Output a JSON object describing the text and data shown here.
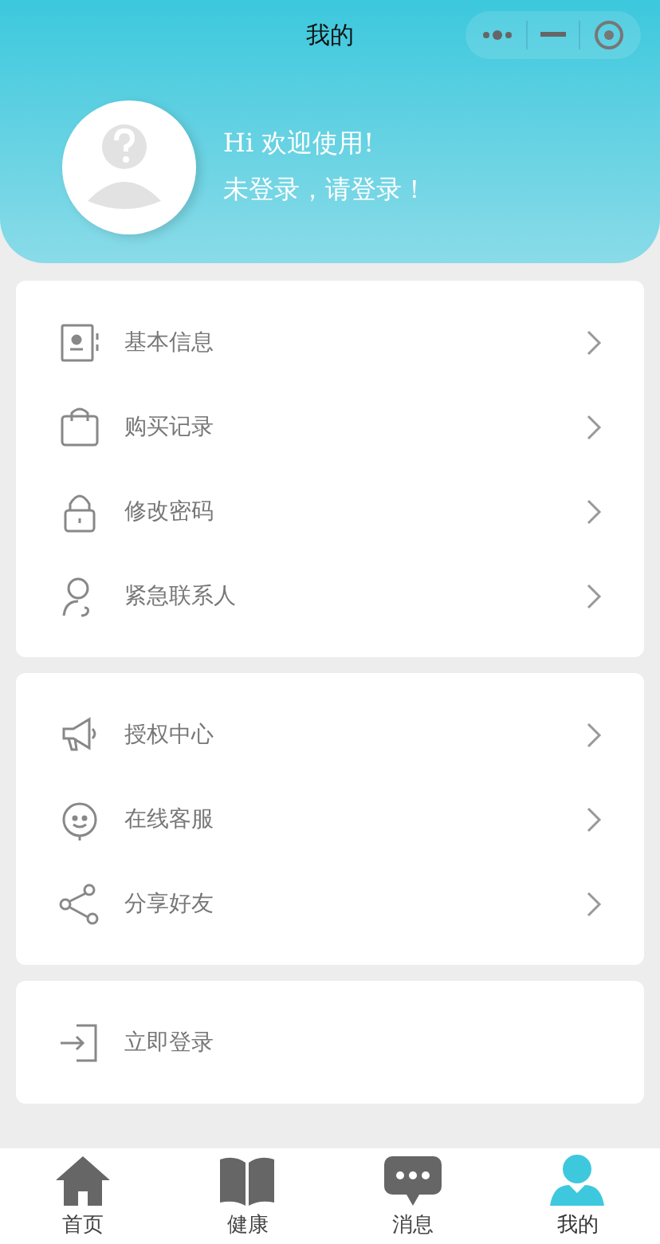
{
  "title": "我的",
  "profile": {
    "greeting": "Hi 欢迎使用!",
    "status": "未登录，请登录！"
  },
  "groups": [
    {
      "items": [
        {
          "kind": "card",
          "label": "基本信息",
          "arrow": true
        },
        {
          "kind": "bag",
          "label": "购买记录",
          "arrow": true
        },
        {
          "kind": "lock",
          "label": "修改密码",
          "arrow": true
        },
        {
          "kind": "contact",
          "label": "紧急联系人",
          "arrow": true
        }
      ]
    },
    {
      "items": [
        {
          "kind": "megaphone",
          "label": "授权中心",
          "arrow": true
        },
        {
          "kind": "service",
          "label": "在线客服",
          "arrow": true
        },
        {
          "kind": "share",
          "label": "分享好友",
          "arrow": true
        }
      ]
    },
    {
      "items": [
        {
          "kind": "login",
          "label": "立即登录",
          "arrow": false
        }
      ]
    }
  ],
  "tabs": [
    {
      "kind": "home",
      "label": "首页",
      "selected": false
    },
    {
      "kind": "book",
      "label": "健康",
      "selected": false
    },
    {
      "kind": "chat",
      "label": "消息",
      "selected": false
    },
    {
      "kind": "user",
      "label": "我的",
      "selected": true
    }
  ]
}
